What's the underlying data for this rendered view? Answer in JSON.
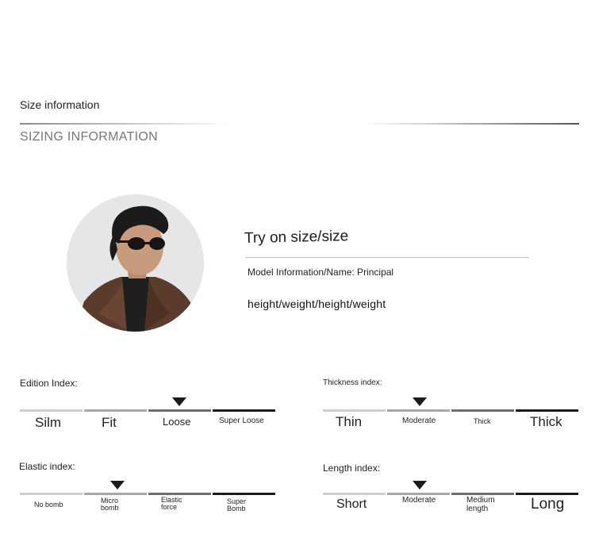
{
  "section": {
    "title": "Size information",
    "subtitle": "SIZING INFORMATION"
  },
  "model": {
    "try_title": "Try on size/size",
    "info": "Model Information/Name: Principal",
    "height_weight": "height/weight/height/weight"
  },
  "indexes": {
    "edition": {
      "title": "Edition Index:",
      "labels": [
        "Silm",
        "Fit",
        "Loose",
        "Super Loose"
      ],
      "selected": 2
    },
    "thickness": {
      "title": "Thickness index:",
      "labels": [
        "Thin",
        "Moderate",
        "Thick",
        "Thick"
      ],
      "selected": 1
    },
    "elastic": {
      "title": "Elastic index:",
      "labels": [
        "No bomb",
        "Micro bomb",
        "Elastic force",
        "Super Bomb"
      ],
      "selected": 1
    },
    "length": {
      "title": "Length index:",
      "labels": [
        "Short",
        "Moderate",
        "Medium length",
        "Long"
      ],
      "selected": 1
    }
  }
}
